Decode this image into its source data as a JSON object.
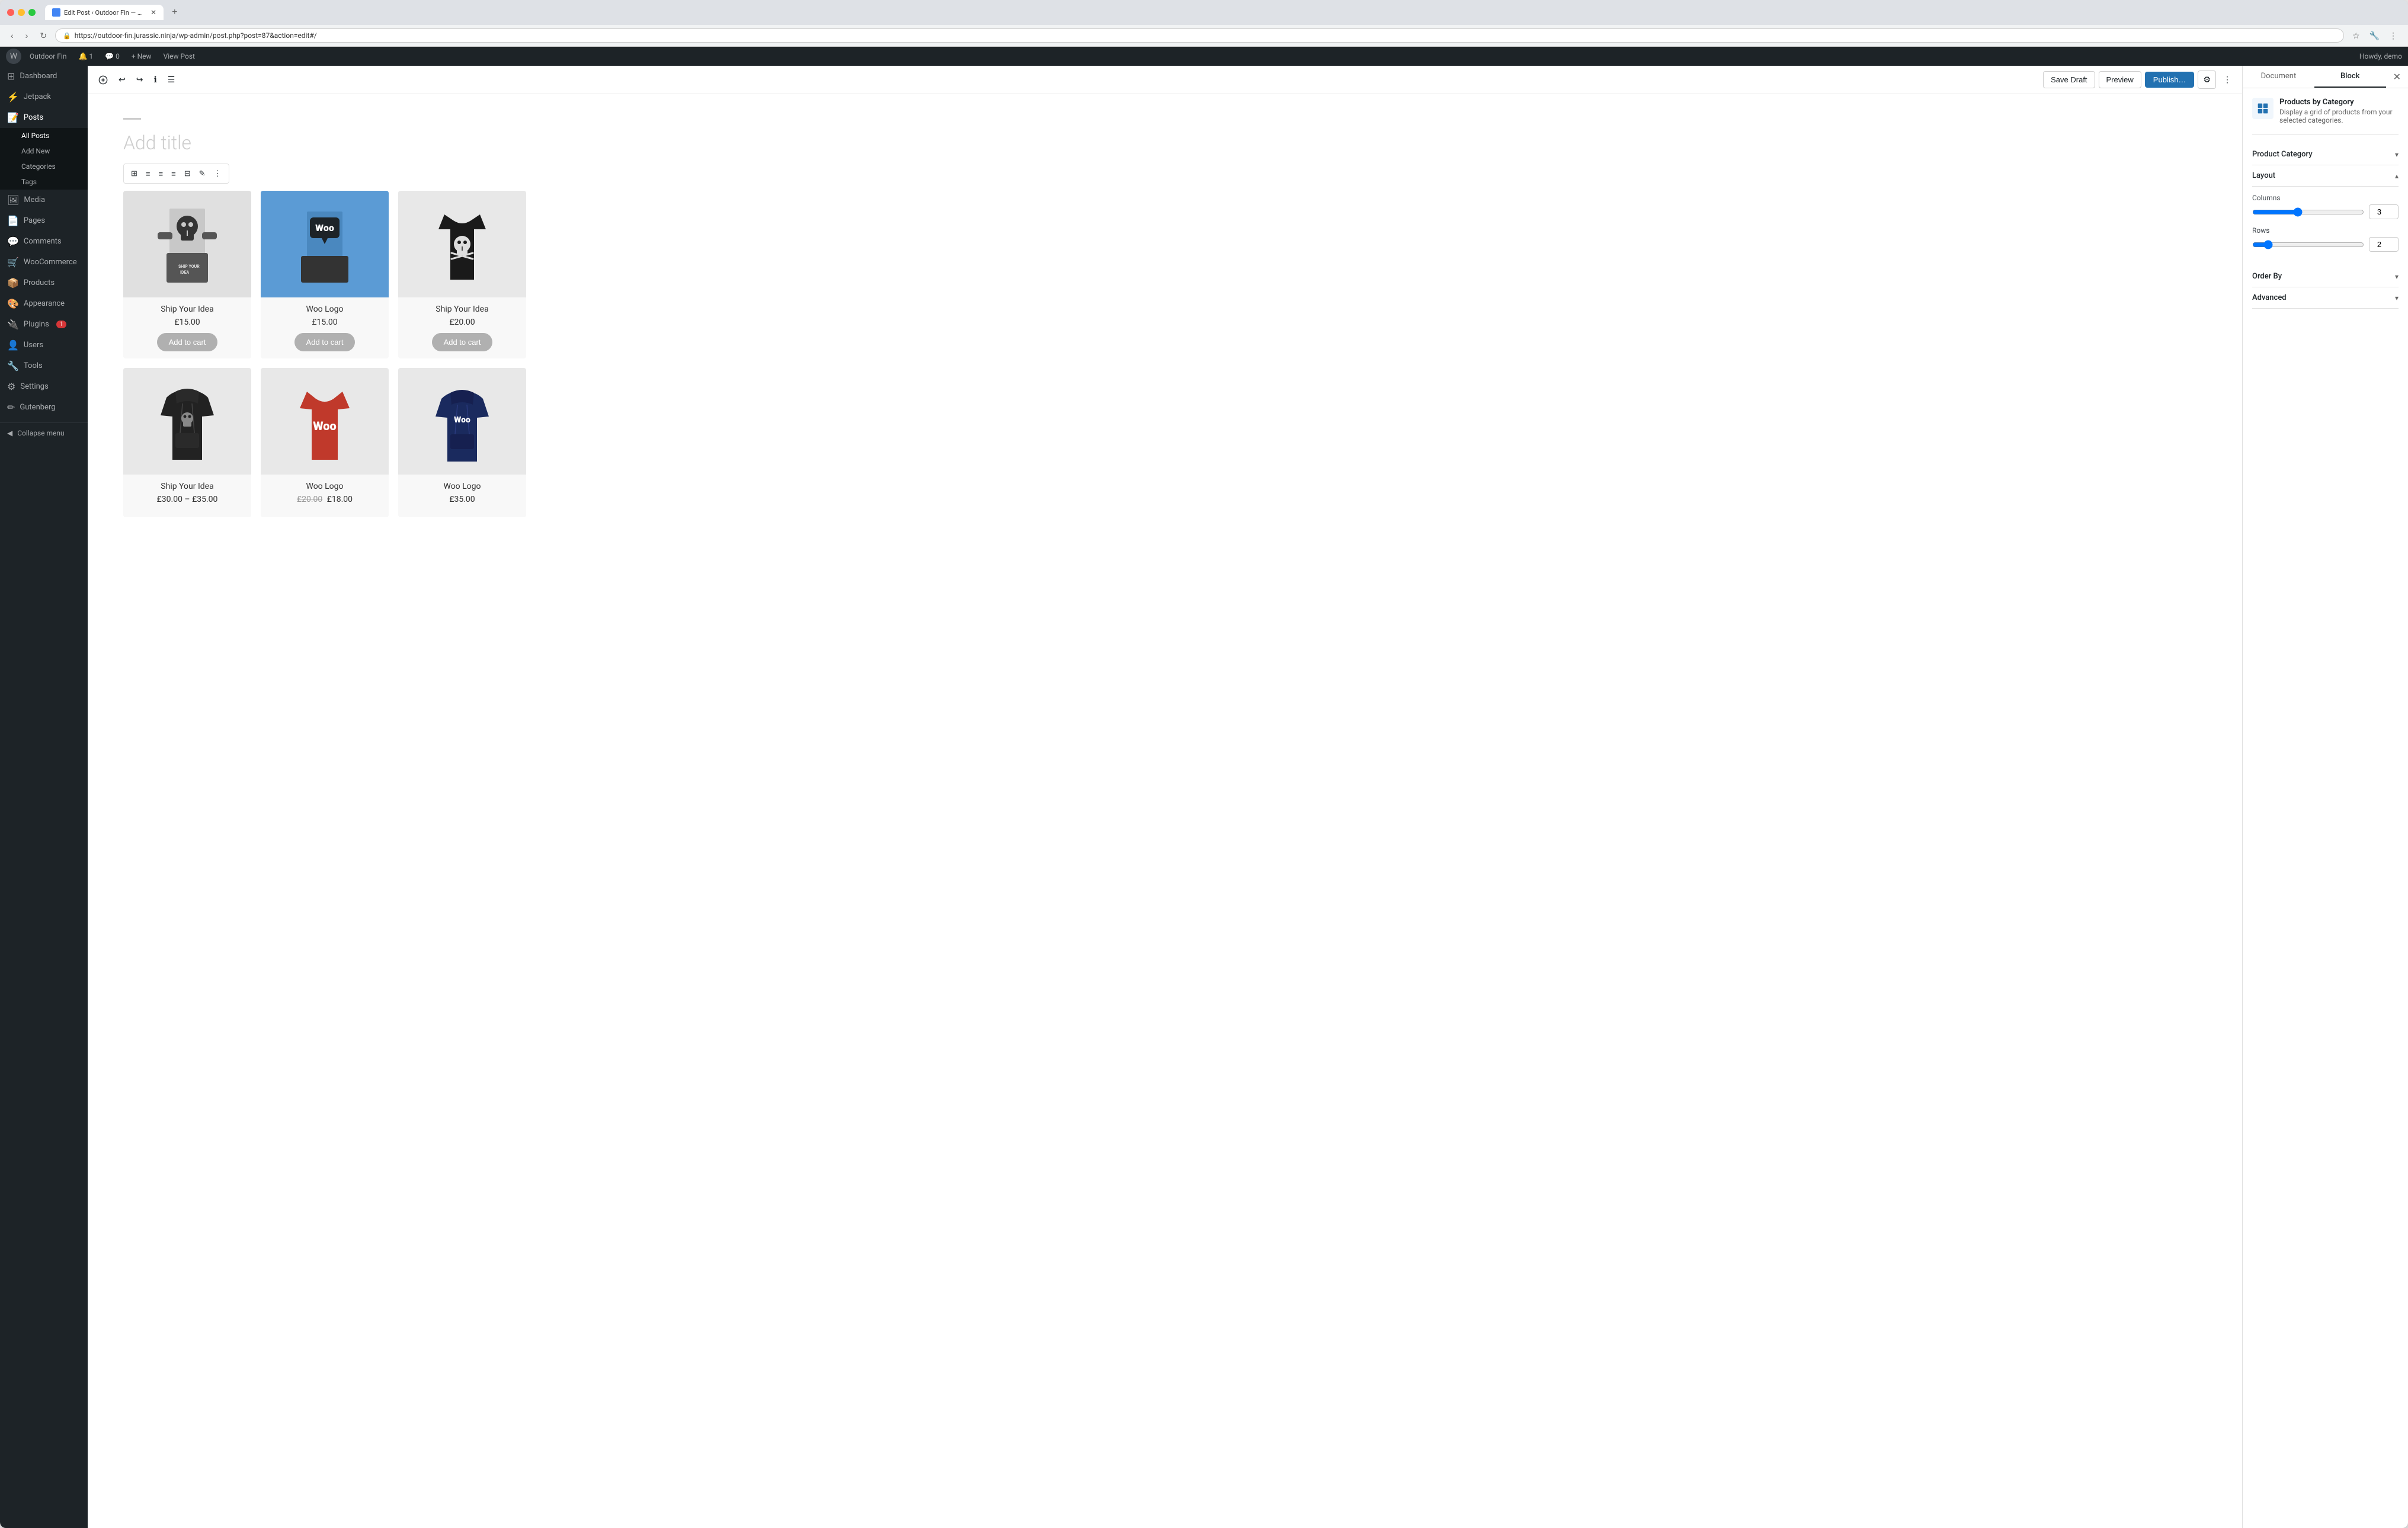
{
  "browser": {
    "tab_title": "Edit Post ‹ Outdoor Fin — Wo…",
    "url": "https://outdoor-fin.jurassic.ninja/wp-admin/post.php?post=87&action=edit#/",
    "new_tab_label": "+"
  },
  "admin_bar": {
    "site_name": "Outdoor Fin",
    "items": [
      "1",
      "0",
      "+ New",
      "View Post"
    ],
    "howdy": "Howdy, demo"
  },
  "sidebar": {
    "items": [
      {
        "label": "Dashboard",
        "icon": "⊞"
      },
      {
        "label": "Jetpack",
        "icon": "🔌"
      },
      {
        "label": "Posts",
        "icon": "📝",
        "active": true
      },
      {
        "label": "Media",
        "icon": "🖼"
      },
      {
        "label": "Pages",
        "icon": "📄"
      },
      {
        "label": "Comments",
        "icon": "💬"
      },
      {
        "label": "WooCommerce",
        "icon": "🛒"
      },
      {
        "label": "Products",
        "icon": "📦"
      },
      {
        "label": "Appearance",
        "icon": "🎨"
      },
      {
        "label": "Plugins",
        "icon": "🔌",
        "badge": "1"
      },
      {
        "label": "Users",
        "icon": "👤"
      },
      {
        "label": "Tools",
        "icon": "🔧"
      },
      {
        "label": "Settings",
        "icon": "⚙"
      },
      {
        "label": "Gutenberg",
        "icon": "✏"
      }
    ],
    "submenu": [
      "All Posts",
      "Add New",
      "Categories",
      "Tags"
    ],
    "collapse_label": "Collapse menu"
  },
  "editor": {
    "post_title_placeholder": "Add title",
    "save_draft_label": "Save Draft",
    "preview_label": "Preview",
    "publish_label": "Publish…"
  },
  "products": [
    {
      "name": "Ship Your Idea",
      "price": "£15.00",
      "type": "skull_poster",
      "bg": "#e8e8e8"
    },
    {
      "name": "Woo Logo",
      "price": "£15.00",
      "type": "woo_blue",
      "bg": "#5b9bd5"
    },
    {
      "name": "Ship Your Idea",
      "price": "£20.00",
      "type": "skull_tshirt_black",
      "bg": "#e8e8e8"
    },
    {
      "name": "Ship Your Idea",
      "price": "£30.00 – £35.00",
      "type": "skull_hoodie_black",
      "bg": "#e8e8e8"
    },
    {
      "name": "Woo Logo",
      "price_original": "£20.00",
      "price_sale": "£18.00",
      "type": "woo_red_tshirt",
      "bg": "#e8e8e8"
    },
    {
      "name": "Woo Logo",
      "price": "£35.00",
      "type": "woo_navy_hoodie",
      "bg": "#e8e8e8"
    }
  ],
  "add_to_cart_label": "Add to cart",
  "right_panel": {
    "document_tab": "Document",
    "block_tab": "Block",
    "block_name": "Products by Category",
    "block_desc": "Display a grid of products from your selected categories.",
    "sections": [
      {
        "title": "Product Category",
        "collapsed": true
      },
      {
        "title": "Layout",
        "collapsed": false
      },
      {
        "title": "Order By",
        "collapsed": true
      },
      {
        "title": "Advanced",
        "collapsed": true
      }
    ],
    "layout": {
      "columns_label": "Columns",
      "columns_value": "3",
      "rows_label": "Rows",
      "rows_value": "2"
    }
  }
}
